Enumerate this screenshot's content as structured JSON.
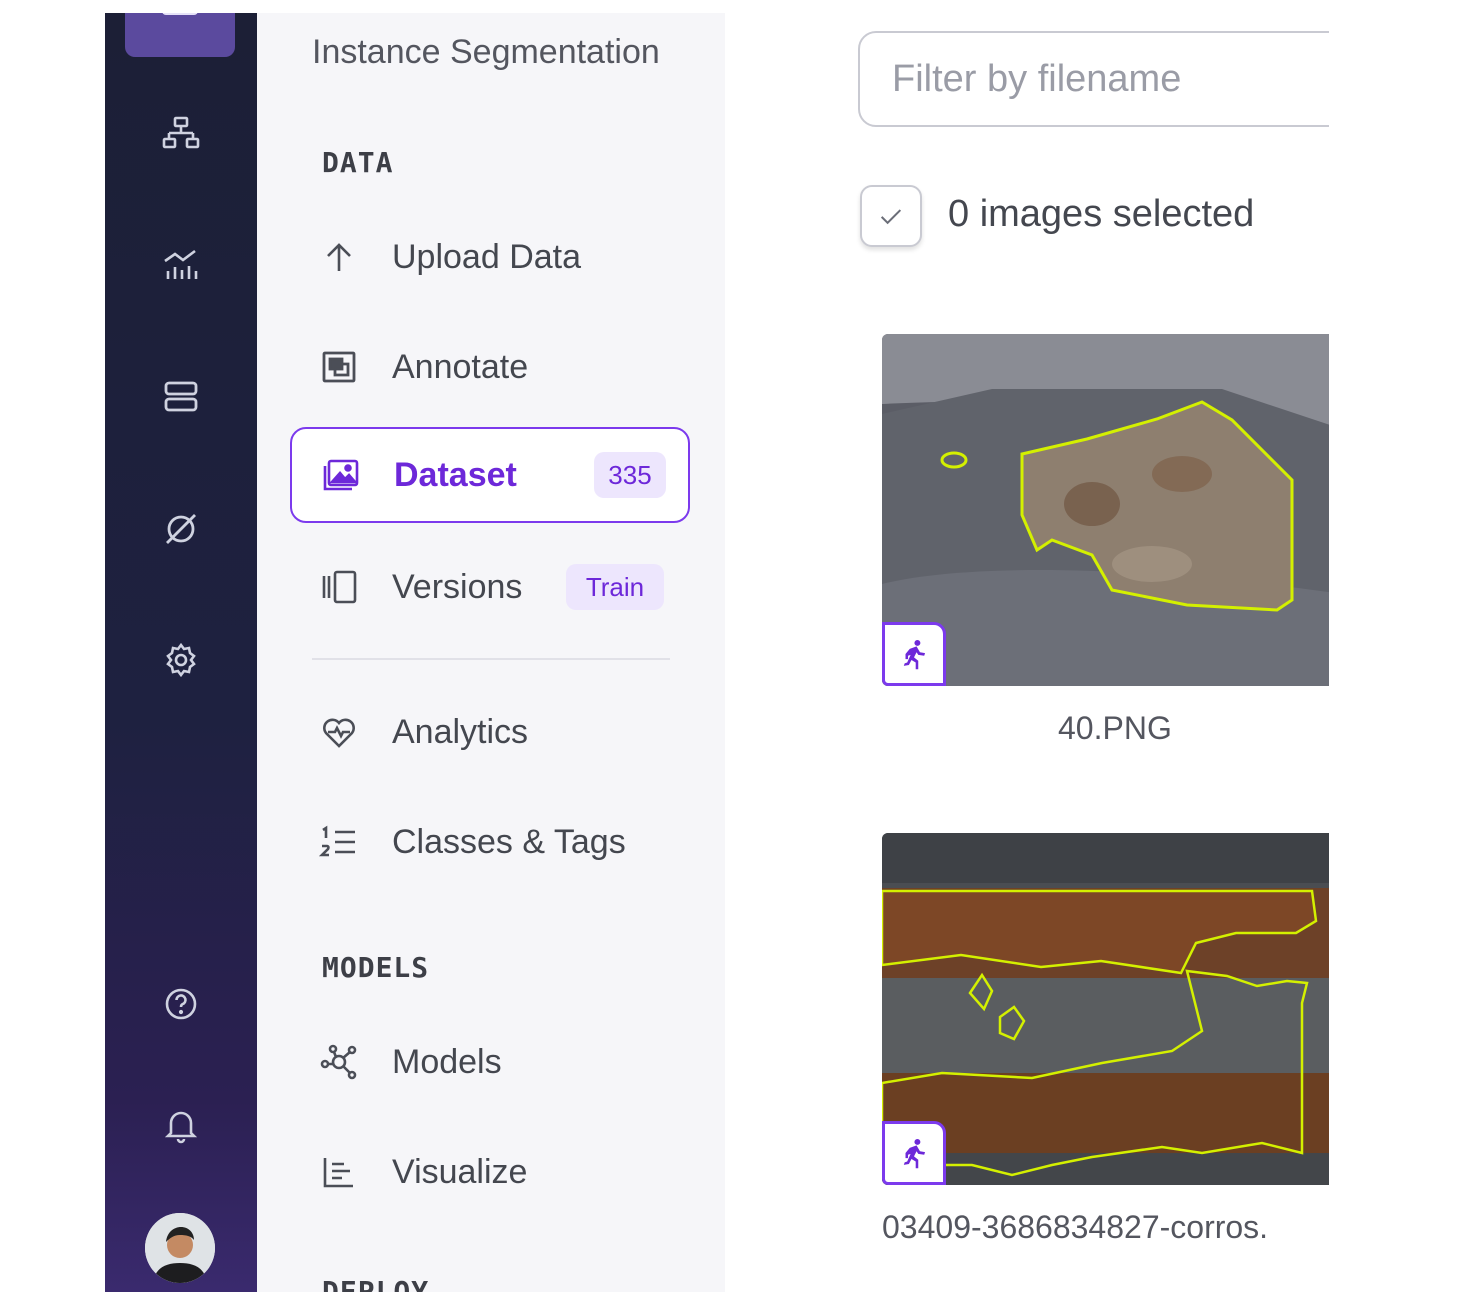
{
  "sidebar": {
    "project_type": "Instance Segmentation",
    "sections": {
      "data": "DATA",
      "models": "MODELS",
      "deploy": "DEPLOY"
    },
    "items": [
      {
        "label": "Upload Data",
        "icon": "upload-arrow-icon"
      },
      {
        "label": "Annotate",
        "icon": "annotate-icon"
      },
      {
        "label": "Dataset",
        "icon": "image-gallery-icon",
        "count": "335",
        "active": true
      },
      {
        "label": "Versions",
        "icon": "versions-icon",
        "badge": "Train"
      },
      {
        "label": "Analytics",
        "icon": "heart-pulse-icon"
      },
      {
        "label": "Classes & Tags",
        "icon": "numbered-list-icon"
      },
      {
        "label": "Models",
        "icon": "model-graph-icon"
      },
      {
        "label": "Visualize",
        "icon": "bar-chart-icon"
      }
    ]
  },
  "rail": {
    "icons": [
      "workflow-icon",
      "monitoring-icon",
      "server-icon",
      "deploy-icon",
      "settings-icon",
      "help-icon",
      "notifications-icon",
      "user-avatar"
    ]
  },
  "main": {
    "filter_placeholder": "Filter by filename",
    "selection_status": "0 images selected",
    "images": [
      {
        "filename": "40.PNG",
        "badge_icon": "running-person-icon"
      },
      {
        "filename": "03409-3686834827-corros.",
        "badge_icon": "running-person-icon"
      }
    ]
  },
  "colors": {
    "accent": "#7c3aed",
    "rail_bg": "#1e2140",
    "sidebar_bg": "#f6f6f9",
    "annotation_outline": "#d4f000"
  }
}
